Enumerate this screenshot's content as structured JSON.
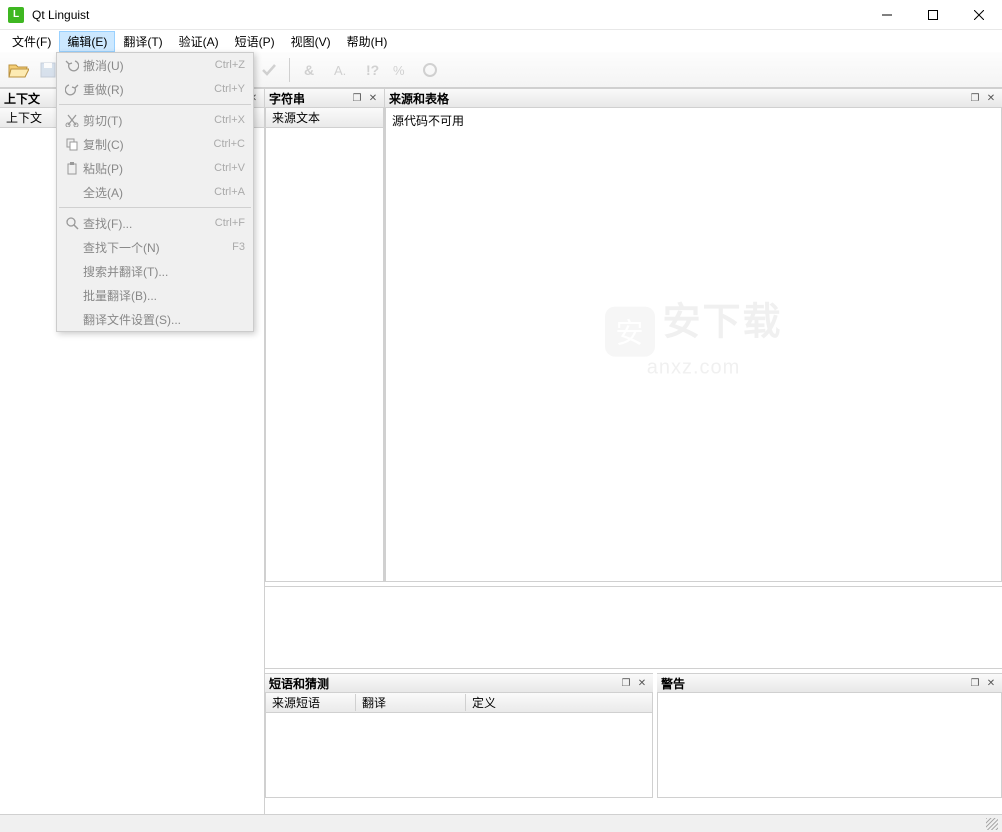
{
  "window": {
    "title": "Qt Linguist"
  },
  "menubar": {
    "items": [
      {
        "label": "文件(F)"
      },
      {
        "label": "编辑(E)"
      },
      {
        "label": "翻译(T)"
      },
      {
        "label": "验证(A)"
      },
      {
        "label": "短语(P)"
      },
      {
        "label": "视图(V)"
      },
      {
        "label": "帮助(H)"
      }
    ],
    "active_index": 1
  },
  "edit_menu": [
    {
      "icon": "undo",
      "label": "撤消(U)",
      "shortcut": "Ctrl+Z",
      "disabled": true
    },
    {
      "icon": "redo",
      "label": "重做(R)",
      "shortcut": "Ctrl+Y",
      "disabled": true
    },
    {
      "sep": true
    },
    {
      "icon": "cut",
      "label": "剪切(T)",
      "shortcut": "Ctrl+X",
      "disabled": true
    },
    {
      "icon": "copy",
      "label": "复制(C)",
      "shortcut": "Ctrl+C",
      "disabled": true
    },
    {
      "icon": "paste",
      "label": "粘贴(P)",
      "shortcut": "Ctrl+V",
      "disabled": true
    },
    {
      "icon": "",
      "label": "全选(A)",
      "shortcut": "Ctrl+A",
      "disabled": true
    },
    {
      "sep": true
    },
    {
      "icon": "find",
      "label": "查找(F)...",
      "shortcut": "Ctrl+F",
      "disabled": true
    },
    {
      "icon": "",
      "label": "查找下一个(N)",
      "shortcut": "F3",
      "disabled": true
    },
    {
      "icon": "",
      "label": "搜索并翻译(T)...",
      "shortcut": "",
      "disabled": true
    },
    {
      "icon": "",
      "label": "批量翻译(B)...",
      "shortcut": "",
      "disabled": true
    },
    {
      "icon": "",
      "label": "翻译文件设置(S)...",
      "shortcut": "",
      "disabled": true
    }
  ],
  "panels": {
    "context": {
      "title": "上下文",
      "column": "上下文"
    },
    "strings": {
      "title": "字符串",
      "column": "来源文本"
    },
    "source": {
      "title": "来源和表格",
      "message": "源代码不可用"
    },
    "phrases": {
      "title": "短语和猜测",
      "columns": [
        "来源短语",
        "翻译",
        "定义"
      ]
    },
    "warnings": {
      "title": "警告"
    }
  },
  "watermark": {
    "main": "安下载",
    "sub": "anxz.com"
  }
}
